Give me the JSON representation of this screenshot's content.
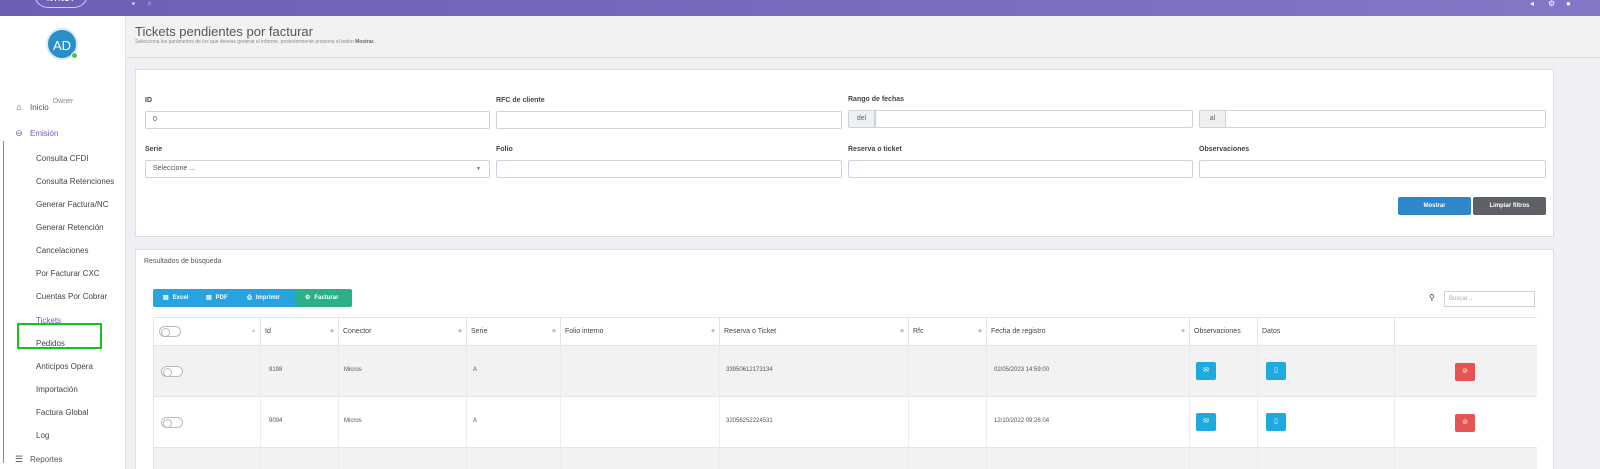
{
  "topbar": {
    "logo_text": "NYNCY"
  },
  "user": {
    "initials": "AD",
    "role": "Owner"
  },
  "nav": {
    "inicio": "Inicio",
    "emision": "Emisión",
    "reportes": "Reportes",
    "emision_items": [
      "Consulta CFDI",
      "Consulta Retenciones",
      "Generar Factura/NC",
      "Generar Retención",
      "Cancelaciones",
      "Por Facturar CXC",
      "Cuentas Por Cobrar",
      "Tickets",
      "Pedidos",
      "Anticipos Opera",
      "Importación",
      "Factura Global",
      "Log"
    ]
  },
  "page": {
    "title": "Tickets pendientes por facturar",
    "subtitle": "Selecciona los parámetros de los que deseas generar el informe, posteriormente presiona el botón",
    "subtitle_bold": "Mostrar."
  },
  "filters": {
    "id_label": "ID",
    "id_value": "0",
    "rfc_label": "RFC de cliente",
    "rfc_value": "",
    "range_label": "Rango de fechas",
    "from_addon": "del",
    "to_addon": "al",
    "serie_label": "Serie",
    "serie_value": "Seleccione ...",
    "folio_label": "Folio",
    "reserva_label": "Reserva o ticket",
    "obs_label": "Observaciones",
    "show_button": "Mostrar",
    "clear_button": "Limpiar filtros"
  },
  "results": {
    "title": "Resultados de búsqueda",
    "export_buttons": [
      "Excel",
      "PDF",
      "Imprimir",
      "Facturar"
    ],
    "search_placeholder": "Buscar...",
    "columns": [
      "Id",
      "Conector",
      "Serie",
      "Folio interno",
      "Reserva o Ticket",
      "Rfc",
      "Fecha de registro",
      "Observaciones",
      "Datos"
    ],
    "rows": [
      {
        "id": "9198",
        "conector": "Micros",
        "serie": "A",
        "folio": "",
        "reserva": "33950612173134",
        "rfc": "",
        "fecha": "02/05/2023 14:59:00"
      },
      {
        "id": "9094",
        "conector": "Micros",
        "serie": "A",
        "folio": "",
        "reserva": "32056252224531",
        "rfc": "",
        "fecha": "12/10/2022 09:26:04"
      }
    ]
  },
  "colors": {
    "topbar": "#7a6dc0",
    "primary_button": "#2f86c9",
    "secondary_button": "#5d6166",
    "excel": "#29a3e0",
    "facturar": "#2cb08a",
    "cyan_action": "#1ea9df",
    "red_action": "#e55353",
    "selection_outline": "#19c219"
  }
}
